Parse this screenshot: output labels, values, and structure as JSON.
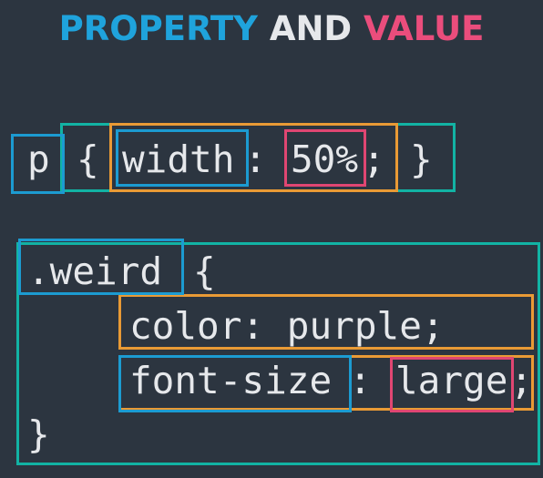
{
  "title": {
    "property": "PROPERTY",
    "and": "AND",
    "value": "VALUE"
  },
  "colors": {
    "background": "#2c3540",
    "property": "#1fa3dc",
    "value": "#ea4d7c",
    "declaration": "#e99a35",
    "rule": "#12b3a4",
    "text": "#e6e8eb"
  },
  "example1": {
    "selector": "p",
    "open_brace": "{",
    "property": "width",
    "colon": ":",
    "value": "50%",
    "semicolon": ";",
    "close_brace": "}"
  },
  "example2": {
    "selector": ".weird",
    "open_brace": "{",
    "decl1": "color: purple;",
    "decl2_property": "font-size",
    "decl2_colon": ":",
    "decl2_value": "large",
    "decl2_semicolon": ";",
    "close_brace": "}"
  }
}
